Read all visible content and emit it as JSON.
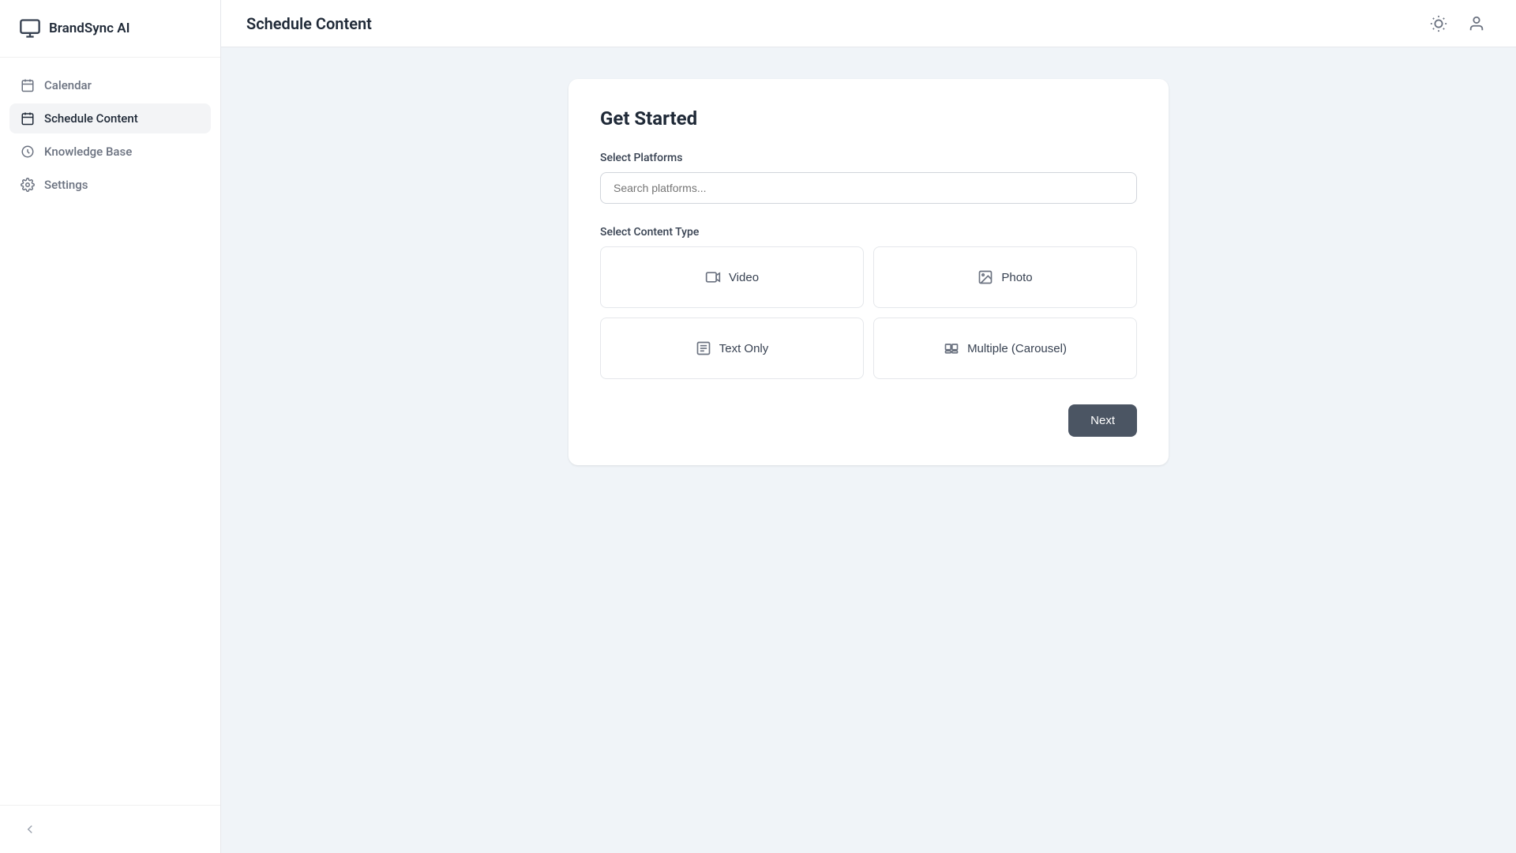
{
  "app": {
    "name": "BrandSync AI"
  },
  "sidebar": {
    "items": [
      {
        "id": "calendar",
        "label": "Calendar",
        "active": false
      },
      {
        "id": "schedule-content",
        "label": "Schedule Content",
        "active": true
      },
      {
        "id": "knowledge-base",
        "label": "Knowledge Base",
        "active": false
      },
      {
        "id": "settings",
        "label": "Settings",
        "active": false
      }
    ],
    "collapse_label": "Collapse"
  },
  "topbar": {
    "title": "Schedule Content"
  },
  "card": {
    "heading": "Get Started",
    "platforms_label": "Select Platforms",
    "platforms_placeholder": "Search platforms...",
    "content_type_label": "Select Content Type",
    "content_types": [
      {
        "id": "video",
        "label": "Video"
      },
      {
        "id": "photo",
        "label": "Photo"
      },
      {
        "id": "text-only",
        "label": "Text Only"
      },
      {
        "id": "multiple-carousel",
        "label": "Multiple (Carousel)"
      }
    ],
    "next_label": "Next"
  }
}
